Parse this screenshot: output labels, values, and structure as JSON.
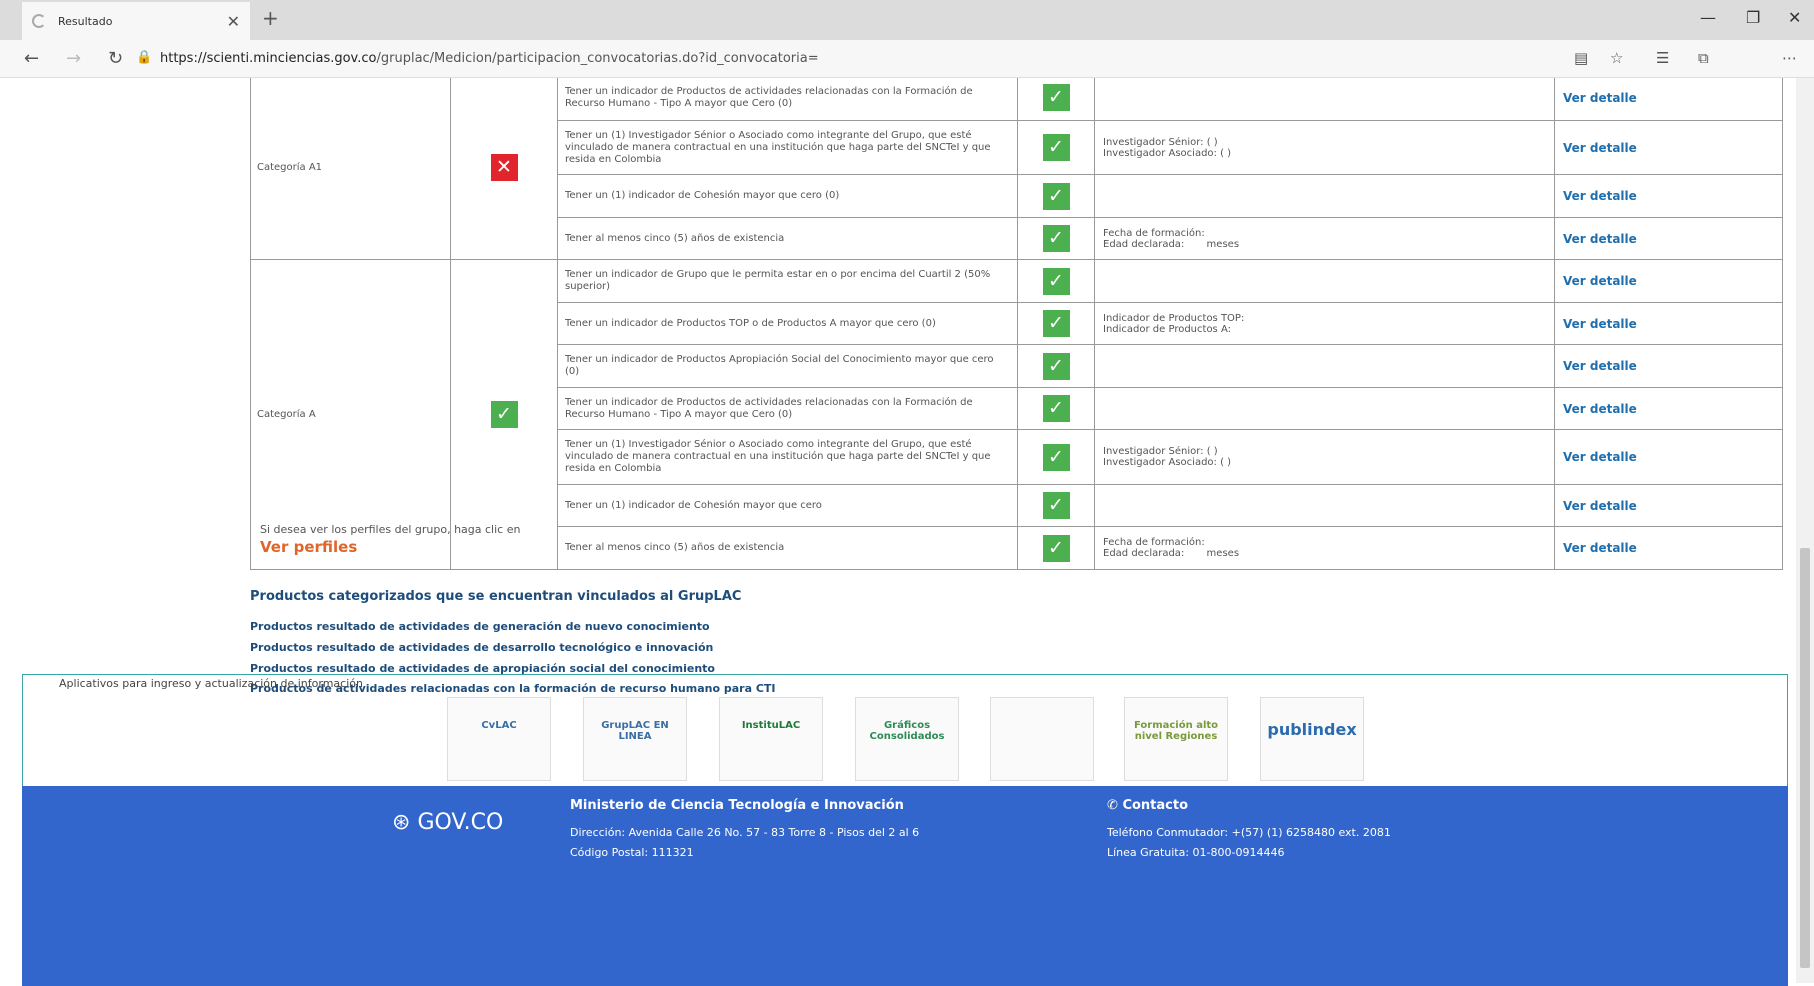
{
  "browser": {
    "tab_title": "Resultado",
    "url_host": "https://scienti.minciencias.gov.co",
    "url_path": "/gruplac/Medicion/participacion_convocatorias.do?id_convocatoria="
  },
  "rows": [
    {
      "desc": "Tener un indicador de Productos de actividades relacionadas con la Formación de Recurso Humano - Tipo A mayor que Cero (0)",
      "info": "",
      "link": "Ver detalle"
    },
    {
      "desc": "Tener un (1) Investigador Sénior o Asociado como integrante del Grupo, que esté vinculado de manera contractual en una institución que haga parte del SNCTeI y que resida en Colombia",
      "info": "Investigador Sénior: ( )\nInvestigador Asociado: ( )",
      "link": "Ver detalle"
    },
    {
      "desc": "Tener un (1) indicador de Cohesión mayor que cero (0)",
      "info": "",
      "link": "Ver detalle"
    },
    {
      "desc": "Tener al menos cinco (5) años de existencia",
      "info": "Fecha de formación:\nEdad declarada:       meses",
      "link": "Ver detalle"
    },
    {
      "desc": "Tener un indicador de Grupo que le permita estar en o por encima del Cuartil 2 (50% superior)",
      "info": "",
      "link": "Ver detalle"
    },
    {
      "desc": "Tener un indicador de Productos TOP o de Productos A mayor que cero (0)",
      "info": "Indicador de Productos TOP:\nIndicador de Productos A:",
      "link": "Ver detalle"
    },
    {
      "desc": "Tener un indicador de Productos Apropiación Social del Conocimiento mayor que cero (0)",
      "info": "",
      "link": "Ver detalle"
    },
    {
      "desc": "Tener un indicador de Productos de actividades relacionadas con la Formación de Recurso Humano - Tipo A mayor que Cero (0)",
      "info": "",
      "link": "Ver detalle"
    },
    {
      "desc": "Tener un (1) Investigador Sénior o Asociado como integrante del Grupo, que esté vinculado de manera contractual en una institución que haga parte del SNCTeI y que resida en Colombia",
      "info": "Investigador Sénior: ( )\nInvestigador Asociado: ( )",
      "link": "Ver detalle"
    },
    {
      "desc": "Tener un (1) indicador de Cohesión mayor que cero",
      "info": "",
      "link": "Ver detalle"
    },
    {
      "desc": "Tener al menos cinco (5) años de existencia",
      "info": "Fecha de formación:\nEdad declarada:       meses",
      "link": "Ver detalle"
    }
  ],
  "categories": {
    "a1": "Categoría A1",
    "a": "Categoría A"
  },
  "perfiles": {
    "text": "Si desea ver los perfiles del grupo, haga clic en",
    "link": "Ver perfiles"
  },
  "products": {
    "title": "Productos categorizados que se encuentran vinculados al GrupLAC",
    "links": [
      "Productos resultado de actividades de generación de nuevo conocimiento",
      "Productos resultado de actividades de desarrollo tecnológico e innovación",
      "Productos resultado de actividades de apropiación social del conocimiento",
      "Productos de actividades relacionadas con la formación de recurso humano para CTI"
    ]
  },
  "apps": {
    "title": "Aplicativos para ingreso y actualización de información",
    "logos": [
      "CvLAC",
      "GrupLAC EN LINEA",
      "InstituLAC",
      "Gráficos Consolidados",
      "",
      "Formación alto nivel Regiones",
      "publindex"
    ]
  },
  "footer": {
    "gov": "GOV.CO",
    "ministry": "Ministerio de Ciencia Tecnología e Innovación",
    "address": "Dirección: Avenida Calle 26 No. 57 - 83 Torre 8 - Pisos del 2 al 6",
    "postal": "Código Postal: 111321",
    "contact_title": "Contacto",
    "phone": "Teléfono Conmutador: +(57) (1) 6258480 ext. 2081",
    "free_line": "Línea Gratuita: 01-800-0914446"
  }
}
